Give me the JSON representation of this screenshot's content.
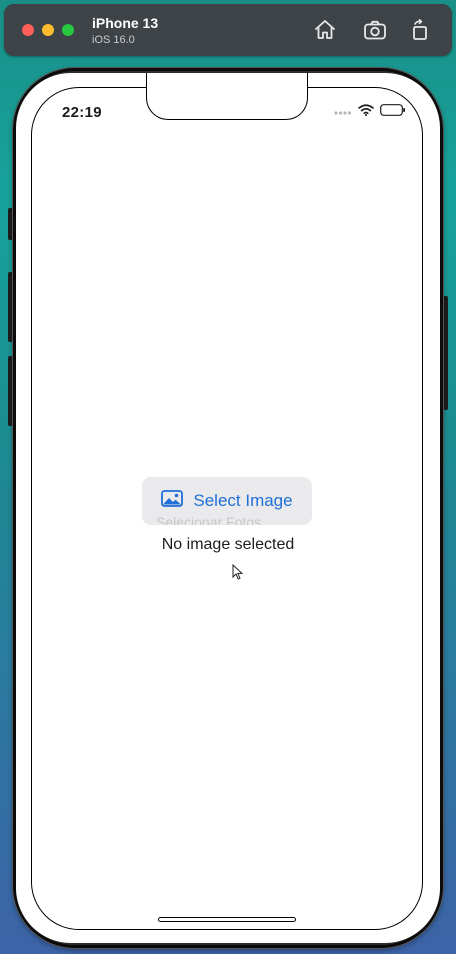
{
  "simulator": {
    "device_name": "iPhone 13",
    "os_version": "iOS 16.0",
    "buttons": {
      "home": "home-icon",
      "screenshot": "camera-icon",
      "rotate": "rotate-icon"
    }
  },
  "status_bar": {
    "time": "22:19",
    "icons": [
      "cellular-dots-icon",
      "wifi-icon",
      "battery-icon"
    ]
  },
  "main": {
    "select_button": {
      "label": "Select Image",
      "icon": "photo-icon"
    },
    "ghost_text": "Selecionar Fotos",
    "empty_state": "No image selected"
  },
  "colors": {
    "accent": "#1f6fd9",
    "button_bg": "#eaeaec",
    "screen_bg": "#ffffff"
  }
}
